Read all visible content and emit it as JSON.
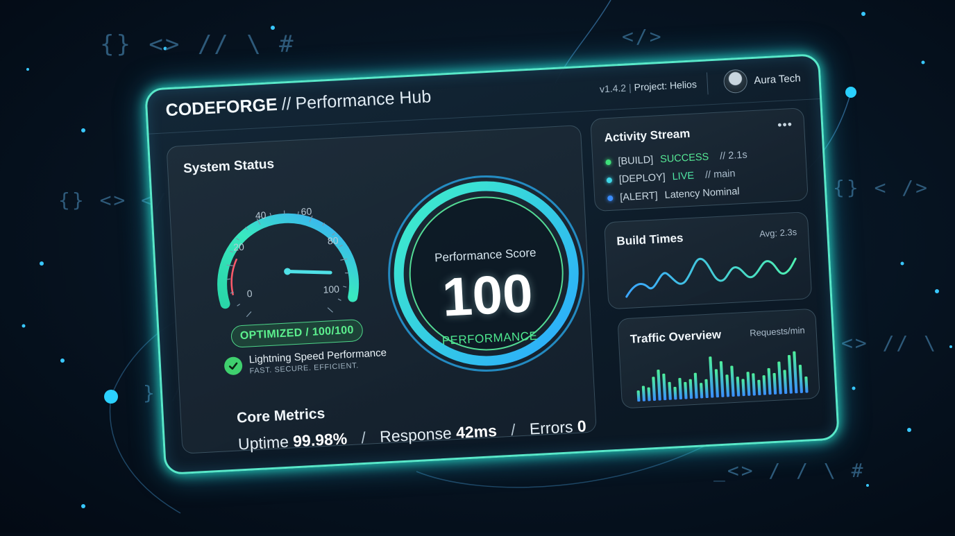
{
  "app": {
    "brand_name": "CODEFORGE",
    "brand_separator": "//",
    "hub_name": "Performance Hub",
    "version": "v1.4.2",
    "meta_separator": "|",
    "project": "Project: Helios",
    "user_name": "Aura Tech"
  },
  "background_glyphs": {
    "top_left": "{} <> // \\ #",
    "top_right": "</>",
    "mid_left": "{} <> </",
    "mid_right": "{} < />",
    "low_right": "<> // \\",
    "low_left": "} /",
    "bottom_right": "_<> / / \\ #"
  },
  "system_status": {
    "title": "System Status",
    "gauge": {
      "value": 85,
      "min": 0,
      "max": 100,
      "tick_labels": [
        "0",
        "20",
        "40",
        "60",
        "80",
        "100"
      ]
    },
    "status_pill": "OPTIMIZED / 100/100",
    "headline": "Lightning Speed Performance",
    "tagline": "FAST. SECURE. EFFICIENT.",
    "score": {
      "title": "Performance Score",
      "value": "100",
      "subtitle": "PERFORMANCE"
    }
  },
  "core_metrics": {
    "title": "Core Metrics",
    "uptime_label": "Uptime",
    "uptime_value": "99.98%",
    "response_label": "Response",
    "response_value": "42ms",
    "errors_label": "Errors",
    "errors_value": "0",
    "separator": "/"
  },
  "activity_stream": {
    "title": "Activity Stream",
    "more_icon": "more-horizontal-icon",
    "items": [
      {
        "tag": "[BUILD]",
        "status": "SUCCESS",
        "comment": "// 2.1s",
        "dot_color": "#3fe07a",
        "status_color": "#56e895"
      },
      {
        "tag": "[DEPLOY]",
        "status": "LIVE",
        "comment": "// main",
        "dot_color": "#3fd6e6",
        "status_color": "#4fe6a4"
      },
      {
        "tag": "[ALERT]",
        "status": "Latency Nominal",
        "comment": "",
        "dot_color": "#3a8dff",
        "status_color": "#c9d8e2"
      }
    ]
  },
  "build_times": {
    "title": "Build Times",
    "note": "Avg: 2.3s"
  },
  "traffic_overview": {
    "title": "Traffic Overview",
    "note": "Requests/min",
    "bar_levels": [
      0.26,
      0.36,
      0.32,
      0.56,
      0.72,
      0.62,
      0.42,
      0.3,
      0.5,
      0.4,
      0.46,
      0.6,
      0.36,
      0.44,
      0.96,
      0.66,
      0.84,
      0.52,
      0.72,
      0.46,
      0.4,
      0.56,
      0.52,
      0.36,
      0.46,
      0.62,
      0.5,
      0.76,
      0.56,
      0.9,
      0.98,
      0.66,
      0.38
    ]
  },
  "colors": {
    "accent_teal": "#59e8c9",
    "accent_cyan": "#38c8ff",
    "accent_green": "#4ee88f",
    "gauge_warn": "#ff5a6a"
  }
}
